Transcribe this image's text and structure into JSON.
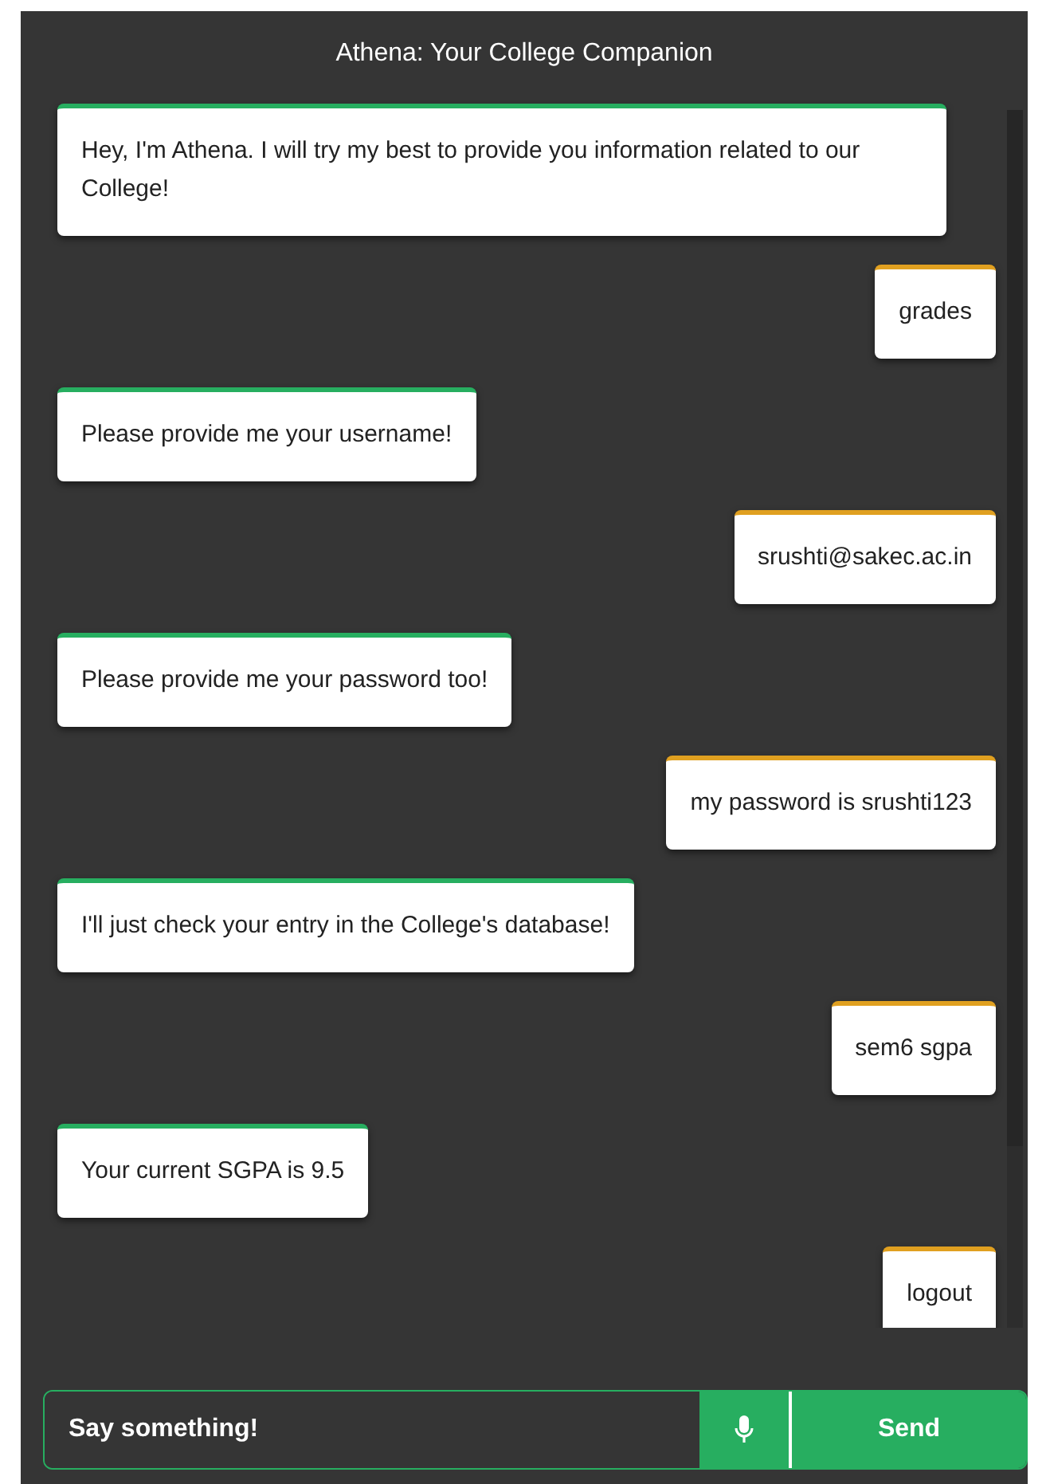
{
  "window": {
    "title": "Athena: Your College Companion"
  },
  "messages": [
    {
      "kind": "bot",
      "text": "Hey, I'm Athena. I will try my best to provide you information related to our College!"
    },
    {
      "kind": "user",
      "text": "grades"
    },
    {
      "kind": "bot",
      "text": "Please provide me your username!"
    },
    {
      "kind": "user",
      "text": "srushti@sakec.ac.in"
    },
    {
      "kind": "bot",
      "text": "Please provide me your password too!"
    },
    {
      "kind": "user",
      "text": "my password is srushti123"
    },
    {
      "kind": "bot",
      "text": "I'll just check your entry in the College's database!"
    },
    {
      "kind": "user",
      "text": "sem6 sgpa"
    },
    {
      "kind": "bot",
      "text": "Your current SGPA is 9.5"
    },
    {
      "kind": "user",
      "text": "logout"
    }
  ],
  "composer": {
    "placeholder": "Say something!",
    "send_label": "Send"
  }
}
